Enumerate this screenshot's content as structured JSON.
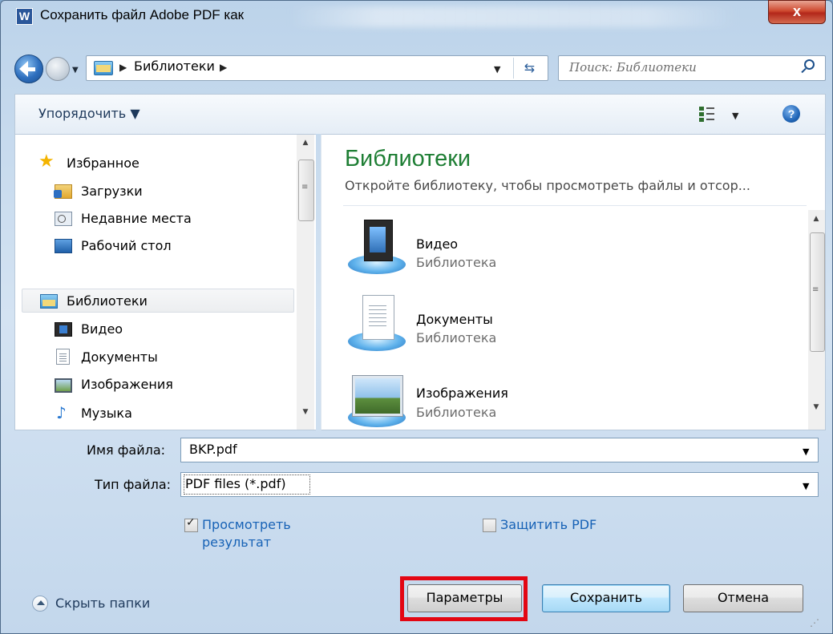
{
  "window": {
    "app_icon_letter": "W",
    "title": "Сохранить файл Adobe PDF как",
    "close_glyph": "x"
  },
  "nav": {
    "back_icon": "back-arrow-icon",
    "forward_icon": "forward-arrow-icon",
    "breadcrumb": [
      "Библиотеки"
    ],
    "search_placeholder": "Поиск: Библиотеки"
  },
  "toolbar": {
    "organize_label": "Упорядочить ▼",
    "view_icon": "view-options-icon",
    "help_glyph": "?"
  },
  "sidebar": {
    "items": [
      {
        "label": "Избранное",
        "icon": "star-icon"
      },
      {
        "label": "Загрузки",
        "icon": "downloads-folder-icon"
      },
      {
        "label": "Недавние места",
        "icon": "recent-places-icon"
      },
      {
        "label": "Рабочий стол",
        "icon": "desktop-icon"
      },
      {
        "label": "Библиотеки",
        "icon": "libraries-icon",
        "selected": true
      },
      {
        "label": "Видео",
        "icon": "video-icon"
      },
      {
        "label": "Документы",
        "icon": "documents-icon"
      },
      {
        "label": "Изображения",
        "icon": "pictures-icon"
      },
      {
        "label": "Музыка",
        "icon": "music-icon"
      }
    ]
  },
  "main": {
    "title": "Библиотеки",
    "subtitle": "Откройте библиотеку, чтобы просмотреть файлы и отсор...",
    "libraries": [
      {
        "name": "Видео",
        "type": "Библиотека",
        "icon": "video-library-icon"
      },
      {
        "name": "Документы",
        "type": "Библиотека",
        "icon": "documents-library-icon"
      },
      {
        "name": "Изображения",
        "type": "Библиотека",
        "icon": "pictures-library-icon"
      }
    ]
  },
  "form": {
    "file_name_label": "Имя файла:",
    "file_name_value": "BKP.pdf",
    "file_type_label": "Тип файла:",
    "file_type_value": "PDF files (*.pdf)",
    "view_result_label_1": "Просмотреть",
    "view_result_label_2": "результат",
    "view_result_checked": true,
    "protect_pdf_label": "Защитить PDF",
    "protect_pdf_checked": false
  },
  "footer": {
    "hide_folders_label": "Скрыть папки",
    "params_label": "Параметры",
    "save_label": "Сохранить",
    "cancel_label": "Отмена"
  },
  "colors": {
    "accent_green": "#1e7e34",
    "highlight_red": "#e30613",
    "link_blue": "#1762b6"
  }
}
